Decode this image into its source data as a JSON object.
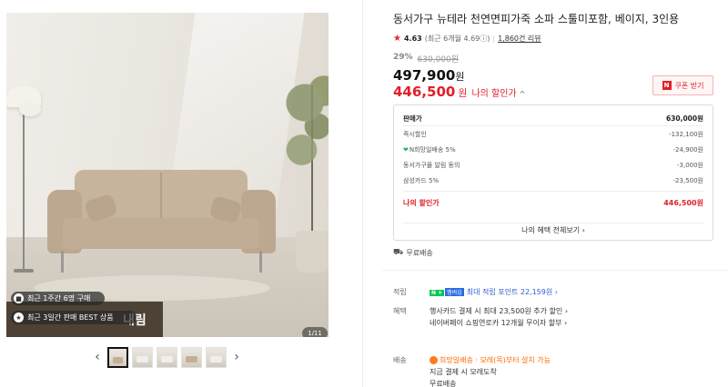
{
  "gallery": {
    "pill_1": "최근 1주간 6명 구매",
    "pill_2": "최근 3일간 판매 BEST 상품",
    "banner": "내림",
    "counter": "1/11",
    "prev_arrow": "‹",
    "next_arrow": "›"
  },
  "product": {
    "title": "동서가구 뉴테라 천연면피가죽 소파 스툴미포함, 베이지, 3인용",
    "rating": "4.63",
    "rating_sub": "(최근 6개월 4.69ⓘ)",
    "review_count": "1,860건 리뷰",
    "discount_pct": "29%",
    "original_price": "630,000원",
    "price": "497,900",
    "price_unit": "원",
    "my_price": "446,500",
    "my_price_unit": "원",
    "my_price_label": "나의 할인가",
    "my_price_chevron": "^",
    "coupon_n": "N",
    "coupon_label": "쿠폰 받기"
  },
  "price_box": {
    "rows": [
      {
        "label": "판매가",
        "value": "630,000원"
      },
      {
        "label": "즉시할인",
        "value": "-132,100원"
      },
      {
        "label": "N희망일배송 5%",
        "value": "-24,900원"
      },
      {
        "label": "동서가구몰 알림 동의",
        "value": "-3,000원"
      },
      {
        "label": "삼성카드 5%",
        "value": "-23,500원"
      }
    ],
    "total_label": "나의 할인가",
    "total_value": "446,500원",
    "link": "나의 혜택 전체보기 ›"
  },
  "delivery": {
    "label": "무료배송"
  },
  "info": {
    "points_label": "적립",
    "npay_badge": "N +",
    "member_badge": "멤버십",
    "points_text": "최대 적립 포인트 22,159원 ›",
    "benefit_label": "혜택",
    "benefit_1": "행사카드 결제 시 최대 23,500원 추가 할인 ›",
    "benefit_2": "네이버페이 쇼핑연로카 12개월 무이자 할부 ›",
    "shipping_label": "배송",
    "shipping_badge": "희망일배송",
    "shipping_1": "· 모레(목)부터 설치 가능",
    "shipping_2": "지금 결제 시 모레도착",
    "shipping_3": "무료배송"
  },
  "colors": {
    "accent_red": "#e0202a",
    "npay_green": "#04c75a",
    "orange": "#ff6a00"
  }
}
